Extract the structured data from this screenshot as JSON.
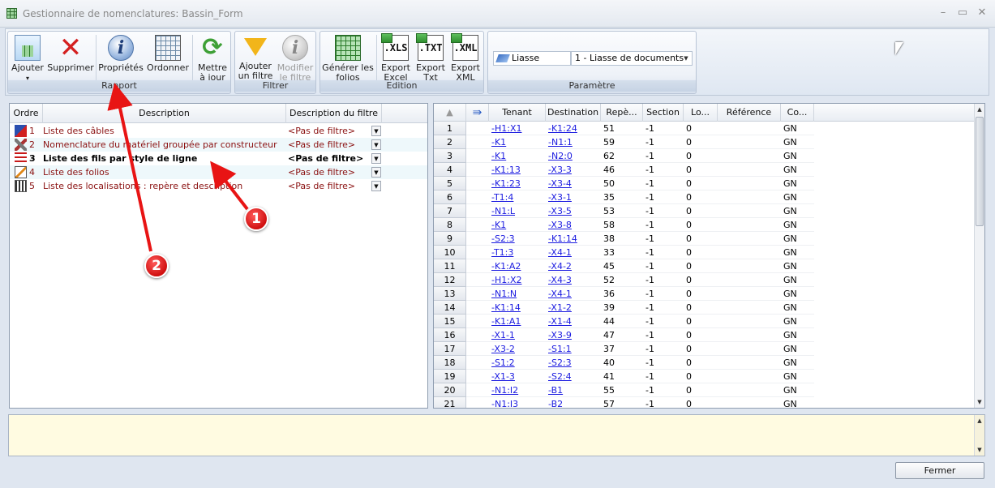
{
  "window": {
    "title": "Gestionnaire de nomenclatures: Bassin_Form"
  },
  "ribbon": {
    "groups": [
      {
        "label": "Rapport",
        "buttons": [
          {
            "label": "Ajouter",
            "icon": "add-report-icon"
          },
          {
            "label": "Supprimer",
            "icon": "delete-icon"
          },
          {
            "label": "Propriétés",
            "icon": "info-icon"
          },
          {
            "label": "Ordonner",
            "icon": "order-icon"
          },
          {
            "label": "Mettre à jour",
            "line1": "Mettre",
            "line2": "à jour",
            "icon": "refresh-icon"
          }
        ]
      },
      {
        "label": "Filtrer",
        "buttons": [
          {
            "line1": "Ajouter",
            "line2": "un filtre",
            "icon": "filter-icon"
          },
          {
            "line1": "Modifier",
            "line2": "le filtre",
            "icon": "info-icon",
            "disabled": true
          }
        ]
      },
      {
        "label": "Edition",
        "buttons": [
          {
            "line1": "Générer les",
            "line2": "folios",
            "icon": "grid-icon"
          },
          {
            "line1": "Export",
            "line2": "Excel",
            "icon": "xls-icon",
            "tag": ".XLS"
          },
          {
            "line1": "Export",
            "line2": "Txt",
            "icon": "txt-icon",
            "tag": ".TXT"
          },
          {
            "line1": "Export",
            "line2": "XML",
            "icon": "xml-icon",
            "tag": ".XML"
          }
        ]
      },
      {
        "label": "Paramètre",
        "field_label": "Liasse",
        "field_value": "1 - Liasse de documents"
      }
    ]
  },
  "reports": {
    "headers": {
      "order": "Ordre",
      "description": "Description",
      "filter": "Description du filtre"
    },
    "rows": [
      {
        "num": "1",
        "description": "Liste des câbles",
        "filter": "<Pas de filtre>"
      },
      {
        "num": "2",
        "description": "Nomenclature du matériel groupée par constructeur",
        "filter": "<Pas de filtre>"
      },
      {
        "num": "3",
        "description": "Liste des fils par style de ligne",
        "filter": "<Pas de filtre>",
        "selected": true
      },
      {
        "num": "4",
        "description": "Liste des folios",
        "filter": "<Pas de filtre>"
      },
      {
        "num": "5",
        "description": "Liste des localisations : repère et description",
        "filter": "<Pas de filtre>"
      }
    ]
  },
  "grid": {
    "headers": [
      "Tenant",
      "Destination",
      "Repè...",
      "Section",
      "Lo...",
      "Référence",
      "Co..."
    ],
    "rows": [
      [
        "1",
        "-H1:X1",
        "-K1:24",
        "51",
        "-1",
        "0",
        "",
        "GN"
      ],
      [
        "2",
        "-K1",
        "-N1:1",
        "59",
        "-1",
        "0",
        "",
        "GN"
      ],
      [
        "3",
        "-K1",
        "-N2:0",
        "62",
        "-1",
        "0",
        "",
        "GN"
      ],
      [
        "4",
        "-K1:13",
        "-X3-3",
        "46",
        "-1",
        "0",
        "",
        "GN"
      ],
      [
        "5",
        "-K1:23",
        "-X3-4",
        "50",
        "-1",
        "0",
        "",
        "GN"
      ],
      [
        "6",
        "-T1:4",
        "-X3-1",
        "35",
        "-1",
        "0",
        "",
        "GN"
      ],
      [
        "7",
        "-N1:L",
        "-X3-5",
        "53",
        "-1",
        "0",
        "",
        "GN"
      ],
      [
        "8",
        "-K1",
        "-X3-8",
        "58",
        "-1",
        "0",
        "",
        "GN"
      ],
      [
        "9",
        "-S2:3",
        "-K1:14",
        "38",
        "-1",
        "0",
        "",
        "GN"
      ],
      [
        "10",
        "-T1:3",
        "-X4-1",
        "33",
        "-1",
        "0",
        "",
        "GN"
      ],
      [
        "11",
        "-K1:A2",
        "-X4-2",
        "45",
        "-1",
        "0",
        "",
        "GN"
      ],
      [
        "12",
        "-H1:X2",
        "-X4-3",
        "52",
        "-1",
        "0",
        "",
        "GN"
      ],
      [
        "13",
        "-N1:N",
        "-X4-1",
        "36",
        "-1",
        "0",
        "",
        "GN"
      ],
      [
        "14",
        "-K1:14",
        "-X1-2",
        "39",
        "-1",
        "0",
        "",
        "GN"
      ],
      [
        "15",
        "-K1:A1",
        "-X1-4",
        "44",
        "-1",
        "0",
        "",
        "GN"
      ],
      [
        "16",
        "-X1-1",
        "-X3-9",
        "47",
        "-1",
        "0",
        "",
        "GN"
      ],
      [
        "17",
        "-X3-2",
        "-S1:1",
        "37",
        "-1",
        "0",
        "",
        "GN"
      ],
      [
        "18",
        "-S1:2",
        "-S2:3",
        "40",
        "-1",
        "0",
        "",
        "GN"
      ],
      [
        "19",
        "-X1-3",
        "-S2:4",
        "41",
        "-1",
        "0",
        "",
        "GN"
      ],
      [
        "20",
        "-N1:I2",
        "-B1",
        "55",
        "-1",
        "0",
        "",
        "GN"
      ],
      [
        "21",
        "-N1:I3",
        "-B2",
        "57",
        "-1",
        "0",
        "",
        "GN"
      ]
    ]
  },
  "annotations": [
    {
      "label": "1"
    },
    {
      "label": "2"
    }
  ],
  "footer": {
    "close_label": "Fermer"
  }
}
